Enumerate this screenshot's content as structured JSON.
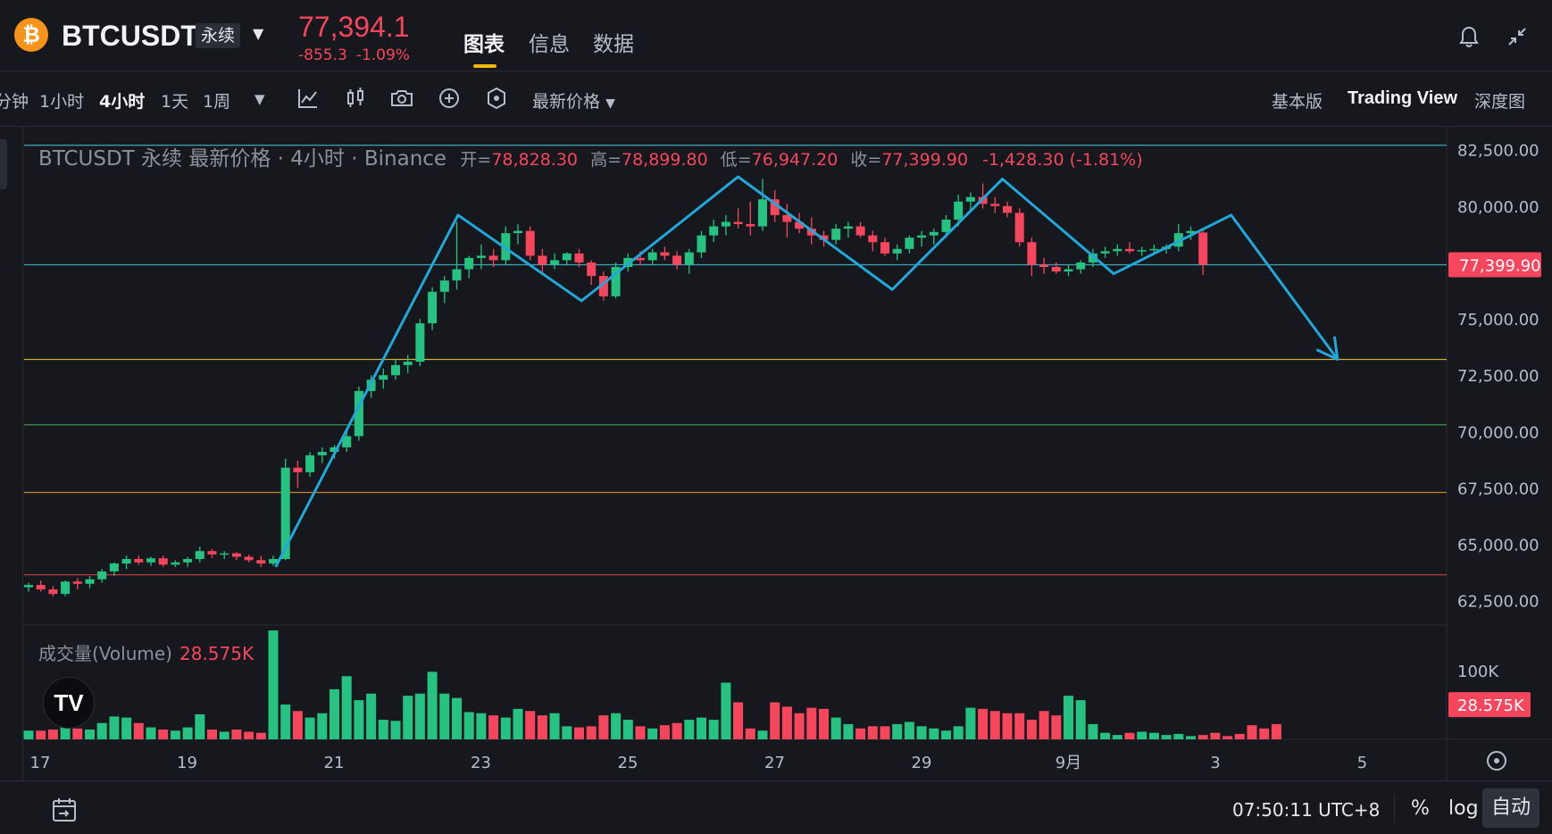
{
  "header": {
    "coin_icon": "bitcoin-icon",
    "coin_glyph": "₿",
    "symbol": "BTCUSDT",
    "contract_type": "永续",
    "last_price": "77,394.1",
    "change_abs": "-855.3",
    "change_pct": "-1.09%",
    "tabs": [
      {
        "label": "图表"
      },
      {
        "label": "信息"
      },
      {
        "label": "数据"
      }
    ]
  },
  "toolbar": {
    "timeframes": [
      "分钟",
      "1小时",
      "4小时",
      "1天",
      "1周"
    ],
    "active_timeframe": "4小时",
    "price_type": "最新价格",
    "views": [
      "基本版",
      "Trading View",
      "深度图"
    ],
    "active_view": "Trading View"
  },
  "legend": {
    "title": "BTCUSDT 永续 最新价格 · 4小时 · Binance",
    "open_label": "开=",
    "open": "78,828.30",
    "high_label": "高=",
    "high": "78,899.80",
    "low_label": "低=",
    "low": "76,947.20",
    "close_label": "收=",
    "close": "77,399.90",
    "change": "-1,428.30 (-1.81%)"
  },
  "volume_legend": {
    "label": "成交量(Volume)",
    "value": "28.575K"
  },
  "tv_logo": "TV",
  "footer": {
    "clock": "07:50:11 UTC+8",
    "percent": "%",
    "log": "log",
    "auto": "自动"
  },
  "colors": {
    "up": "#26c281",
    "down": "#f6465d",
    "pattern": "#22a7d8",
    "level_cyan": "#3aa6b9",
    "level_yellow": "#c9b13a",
    "level_green": "#3a8f55",
    "level_orange": "#c9842e",
    "level_red": "#c7414f"
  },
  "chart_data": {
    "type": "candlestick",
    "y_axis": {
      "min": 61500,
      "max": 83200,
      "ticks": [
        82500,
        80000,
        75000,
        72500,
        70000,
        67500,
        65000,
        62500
      ],
      "tick_labels": [
        "82,500.00",
        "80,000.00",
        "75,000.00",
        "72,500.00",
        "70,000.00",
        "67,500.00",
        "65,000.00",
        "62,500.00"
      ],
      "current_price": 77399.9,
      "current_price_label": "77,399.90"
    },
    "x_axis": {
      "tick_labels": [
        "17",
        "19",
        "21",
        "23",
        "25",
        "27",
        "29",
        "9月",
        "3",
        "5"
      ]
    },
    "candles": [
      [
        63100,
        63300,
        62900,
        63200
      ],
      [
        63200,
        63400,
        62900,
        63000
      ],
      [
        63000,
        63150,
        62700,
        62800
      ],
      [
        62800,
        63400,
        62700,
        63350
      ],
      [
        63350,
        63500,
        63000,
        63250
      ],
      [
        63250,
        63600,
        63050,
        63450
      ],
      [
        63450,
        63900,
        63300,
        63800
      ],
      [
        63800,
        64200,
        63600,
        64150
      ],
      [
        64150,
        64500,
        63900,
        64350
      ],
      [
        64350,
        64500,
        64100,
        64200
      ],
      [
        64200,
        64450,
        64050,
        64380
      ],
      [
        64380,
        64500,
        64000,
        64100
      ],
      [
        64100,
        64300,
        64000,
        64200
      ],
      [
        64200,
        64450,
        64000,
        64350
      ],
      [
        64350,
        64900,
        64200,
        64700
      ],
      [
        64700,
        64800,
        64400,
        64550
      ],
      [
        64550,
        64700,
        64350,
        64600
      ],
      [
        64600,
        64650,
        64300,
        64450
      ],
      [
        64450,
        64550,
        64200,
        64300
      ],
      [
        64300,
        64500,
        64000,
        64150
      ],
      [
        64150,
        64500,
        64050,
        64350
      ],
      [
        64350,
        68800,
        64300,
        68400
      ],
      [
        68400,
        68700,
        67500,
        68200
      ],
      [
        68200,
        69100,
        68000,
        68950
      ],
      [
        68950,
        69300,
        68600,
        69100
      ],
      [
        69100,
        69400,
        68800,
        69300
      ],
      [
        69300,
        70100,
        69100,
        69800
      ],
      [
        69800,
        72000,
        69600,
        71800
      ],
      [
        71800,
        72500,
        71500,
        72300
      ],
      [
        72300,
        72800,
        71900,
        72500
      ],
      [
        72500,
        73200,
        72300,
        72950
      ],
      [
        72950,
        73400,
        72600,
        73100
      ],
      [
        73100,
        75000,
        72900,
        74800
      ],
      [
        74800,
        76400,
        74500,
        76200
      ],
      [
        76200,
        76900,
        75700,
        76700
      ],
      [
        76700,
        79300,
        76300,
        77200
      ],
      [
        77200,
        77800,
        76800,
        77700
      ],
      [
        77700,
        78300,
        77200,
        77800
      ],
      [
        77800,
        78100,
        77300,
        77600
      ],
      [
        77600,
        79100,
        77400,
        78800
      ],
      [
        78800,
        79200,
        78300,
        78900
      ],
      [
        78900,
        79100,
        77600,
        77800
      ],
      [
        77800,
        78100,
        77000,
        77400
      ],
      [
        77400,
        77900,
        77200,
        77600
      ],
      [
        77600,
        77950,
        77400,
        77900
      ],
      [
        77900,
        78100,
        77300,
        77500
      ],
      [
        77500,
        77600,
        76500,
        76900
      ],
      [
        76900,
        77100,
        75800,
        76000
      ],
      [
        76000,
        77500,
        75900,
        77300
      ],
      [
        77300,
        77900,
        77100,
        77700
      ],
      [
        77700,
        78000,
        77400,
        77600
      ],
      [
        77600,
        78100,
        77400,
        77950
      ],
      [
        77950,
        78200,
        77600,
        77800
      ],
      [
        77800,
        78000,
        77200,
        77400
      ],
      [
        77400,
        78100,
        77000,
        77950
      ],
      [
        77950,
        78900,
        77700,
        78700
      ],
      [
        78700,
        79400,
        78400,
        79100
      ],
      [
        79100,
        79600,
        78700,
        79300
      ],
      [
        79300,
        79900,
        79000,
        79200
      ],
      [
        79200,
        80200,
        78700,
        79100
      ],
      [
        79100,
        81200,
        78900,
        80300
      ],
      [
        80300,
        80700,
        79300,
        79600
      ],
      [
        79600,
        80100,
        78600,
        79300
      ],
      [
        79300,
        79700,
        78800,
        79000
      ],
      [
        79000,
        79500,
        78300,
        78700
      ],
      [
        78700,
        78900,
        78200,
        78500
      ],
      [
        78500,
        79200,
        78300,
        79000
      ],
      [
        79000,
        79300,
        78600,
        79100
      ],
      [
        79100,
        79300,
        78600,
        78700
      ],
      [
        78700,
        78900,
        78000,
        78400
      ],
      [
        78400,
        78600,
        77800,
        77900
      ],
      [
        77900,
        78300,
        77600,
        78100
      ],
      [
        78100,
        78700,
        77900,
        78600
      ],
      [
        78600,
        78900,
        78200,
        78700
      ],
      [
        78700,
        79000,
        78300,
        78850
      ],
      [
        78850,
        79600,
        78600,
        79400
      ],
      [
        79400,
        80500,
        79100,
        80200
      ],
      [
        80200,
        80600,
        79800,
        80400
      ],
      [
        80400,
        81000,
        79900,
        80100
      ],
      [
        80100,
        80400,
        79700,
        80000
      ],
      [
        80000,
        80200,
        79500,
        79700
      ],
      [
        79700,
        79900,
        78200,
        78400
      ],
      [
        78400,
        78600,
        76900,
        77400
      ],
      [
        77400,
        77700,
        77000,
        77300
      ],
      [
        77300,
        77500,
        77000,
        77100
      ],
      [
        77100,
        77400,
        76900,
        77200
      ],
      [
        77200,
        77600,
        77000,
        77500
      ],
      [
        77500,
        78100,
        77300,
        77900
      ],
      [
        77900,
        78200,
        77700,
        78000
      ],
      [
        78000,
        78300,
        77800,
        78100
      ],
      [
        78100,
        78400,
        77900,
        78000
      ],
      [
        78000,
        78200,
        77800,
        78050
      ],
      [
        78050,
        78300,
        77900,
        78100
      ],
      [
        78100,
        78300,
        77900,
        78200
      ],
      [
        78200,
        79200,
        78000,
        78800
      ],
      [
        78800,
        79100,
        78500,
        78900
      ],
      [
        78828.3,
        78899.8,
        76947.2,
        77399.9
      ]
    ],
    "volumes": [
      8,
      8,
      9,
      11,
      10,
      9,
      15,
      21,
      20,
      15,
      11,
      9,
      8,
      11,
      23,
      9,
      7,
      9,
      7,
      6,
      100,
      32,
      26,
      20,
      24,
      46,
      58,
      36,
      42,
      18,
      17,
      40,
      42,
      62,
      42,
      38,
      25,
      24,
      22,
      20,
      28,
      26,
      22,
      24,
      12,
      11,
      12,
      22,
      24,
      18,
      12,
      10,
      13,
      15,
      18,
      20,
      18,
      52,
      34,
      10,
      8,
      34,
      30,
      24,
      29,
      28,
      20,
      14,
      10,
      12,
      12,
      14,
      16,
      12,
      10,
      8,
      12,
      29,
      28,
      26,
      24,
      24,
      18,
      26,
      22,
      40,
      36,
      14,
      6,
      4,
      6,
      7,
      6,
      4,
      5,
      3,
      4,
      6,
      3,
      5,
      13,
      10,
      14
    ],
    "volume_axis": {
      "max": 100000,
      "tick_labels": [
        "100K"
      ],
      "current_label": "28.575K"
    },
    "levels": [
      {
        "price": 82700,
        "color": "level_cyan"
      },
      {
        "price": 77399.9,
        "color": "level_cyan"
      },
      {
        "price": 73200,
        "color": "level_yellow"
      },
      {
        "price": 70300,
        "color": "level_green"
      },
      {
        "price": 67300,
        "color": "level_orange"
      },
      {
        "price": 63650,
        "color": "level_red"
      }
    ],
    "pattern_path": [
      [
        20.2,
        64000
      ],
      [
        35.1,
        79600
      ],
      [
        45.2,
        75800
      ],
      [
        58.0,
        81300
      ],
      [
        70.6,
        76300
      ],
      [
        79.6,
        81200
      ],
      [
        88.7,
        77000
      ],
      [
        98.3,
        79600
      ],
      [
        107.0,
        73200
      ]
    ],
    "pattern_arrow": true
  }
}
